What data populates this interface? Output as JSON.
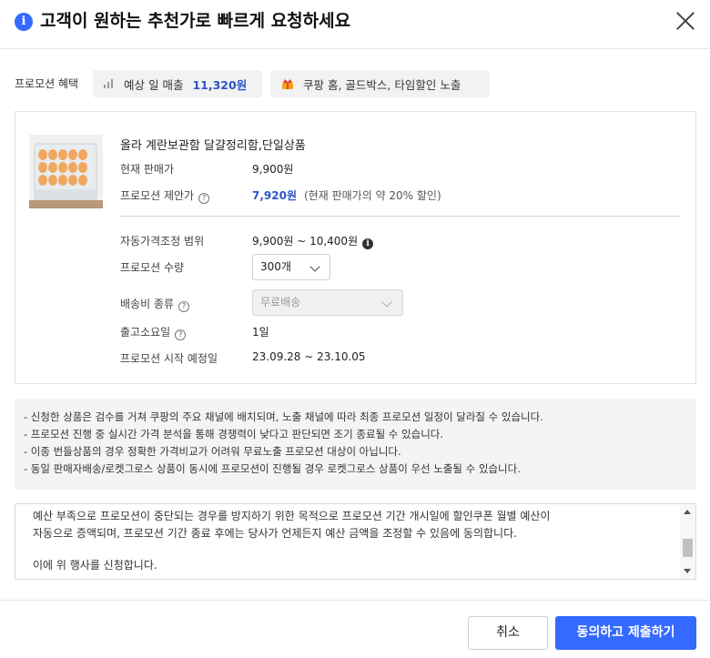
{
  "dialog": {
    "title": "고객이 원하는 추천가로 빠르게 요청하세요",
    "close_icon": "close-icon"
  },
  "benefit": {
    "label": "프로모션 혜택",
    "sales_label": "예상 일 매출",
    "sales_value": "11,320원",
    "exposure_text": "쿠팡 홈, 골드박스, 타임할인 노출"
  },
  "product": {
    "name": "올라 계란보관함 달걀정리함,단일상품",
    "current_price_label": "현재 판매가",
    "current_price": "9,900원",
    "promo_price_label": "프로모션 제안가",
    "promo_price": "7,920원",
    "promo_price_note": "(현재 판매가의 약 20% 할인)",
    "auto_range_label": "자동가격조정 범위",
    "auto_range_value": "9,900원 ~ 10,400원",
    "quantity_label": "프로모션 수량",
    "quantity_value": "300개",
    "shipping_label": "배송비 종류",
    "shipping_value": "무료배송",
    "dispatch_label": "출고소요일",
    "dispatch_value": "1일",
    "start_label": "프로모션 시작 예정일",
    "start_value": "23.09.28 ~ 23.10.05"
  },
  "notices": [
    "- 신청한 상품은 검수를 거쳐 쿠팡의 주요 채널에 배치되며, 노출 채널에 따라 최종 프로모션 일정이 달라질 수 있습니다.",
    "- 프로모션 진행 중 실시간 가격 분석을 통해 경쟁력이 낮다고 판단되면 조기 종료될 수 있습니다.",
    "- 이종 번들상품의 경우 정확한 가격비교가 어려워 무료노출 프로모션 대상이 아닙니다.",
    "- 동일 판매자배송/로켓그로스 상품이 동시에 프로모션이 진행될 경우 로켓그로스 상품이 우선 노출될 수 있습니다."
  ],
  "agreement": {
    "line1": "예산 부족으로 프로모션이 중단되는 경우를 방지하기 위한 목적으로 프로모션 기간 개시일에 할인쿠폰 월별 예산이",
    "line2": "자동으로 증액되며, 프로모션 기간 종료 후에는 당사가 언제든지 예산 금액을 조정할 수 있음에 동의합니다.",
    "line3": "이에 위 행사를 신청합니다."
  },
  "footer": {
    "cancel_label": "취소",
    "submit_label": "동의하고 제출하기"
  },
  "colors": {
    "accent": "#346aff",
    "price_blue": "#2f53c8"
  }
}
